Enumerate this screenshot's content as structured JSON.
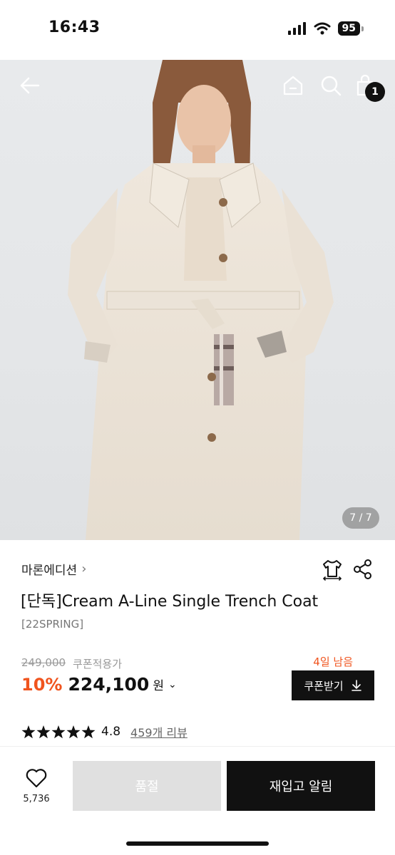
{
  "status_bar": {
    "time": "16:43",
    "battery": "95"
  },
  "header": {
    "cart_count": "1"
  },
  "gallery": {
    "counter": "7 / 7"
  },
  "product": {
    "brand": "마론에디션",
    "title": "[단독]Cream A-Line Single Trench Coat",
    "season": "[22SPRING]",
    "original_price": "249,000",
    "coupon_price_label": "쿠폰적용가",
    "discount": "10%",
    "price": "224,100",
    "currency": "원",
    "days_left": "4일 남음",
    "coupon_button": "쿠폰받기",
    "rating": "4.8",
    "reviews": "459개 리뷰"
  },
  "bottom_bar": {
    "like_count": "5,736",
    "soldout_label": "품절",
    "restock_label": "재입고 알림"
  },
  "colors": {
    "accent": "#f0541e",
    "primary": "#111111",
    "disabled": "#e0e0e0"
  }
}
